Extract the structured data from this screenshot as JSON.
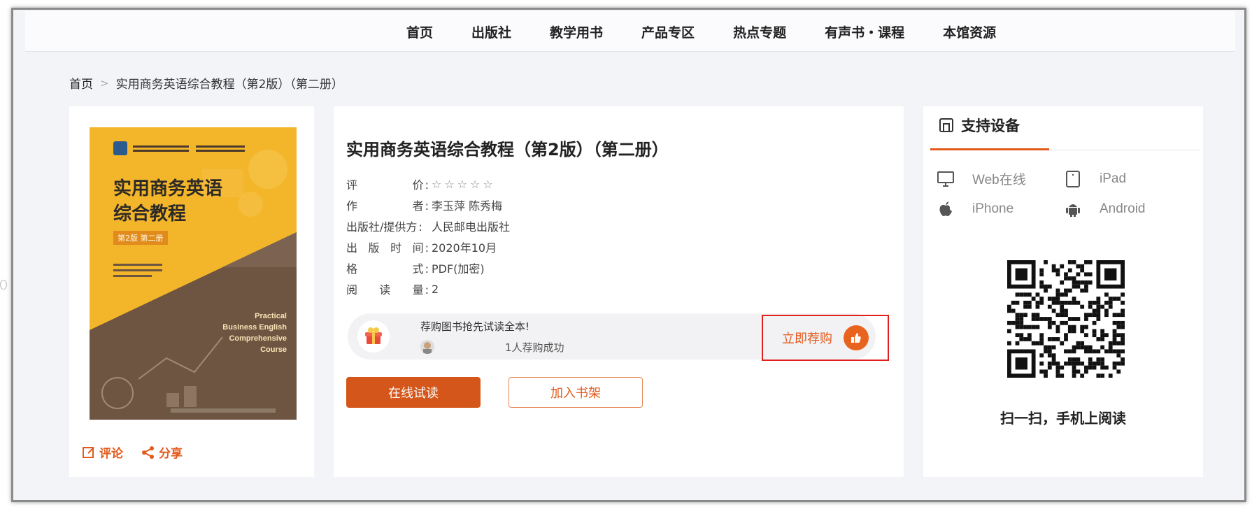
{
  "nav": {
    "items": [
      "首页",
      "出版社",
      "教学用书",
      "产品专区",
      "热点专题",
      "有声书・课程",
      "本馆资源"
    ]
  },
  "breadcrumb": {
    "home": "首页",
    "current": "实用商务英语综合教程（第2版）（第二册）"
  },
  "book": {
    "title": "实用商务英语综合教程（第2版）（第二册）",
    "cover": {
      "title_line1": "实用商务英语",
      "title_line2": "综合教程",
      "edition": "第2版 第二册",
      "english_lines": [
        "Practical",
        "Business English",
        "Comprehensive",
        "Course"
      ]
    },
    "meta": [
      {
        "label_chars": [
          "评",
          "价"
        ],
        "value": "",
        "type": "stars",
        "stars": "☆☆☆☆☆"
      },
      {
        "label_chars": [
          "作",
          "者"
        ],
        "value": "李玉萍 陈秀梅"
      },
      {
        "label_chars": [
          "出版社/提供方"
        ],
        "value": "人民邮电出版社"
      },
      {
        "label_chars": [
          "出",
          "版",
          "时",
          "间"
        ],
        "value": "2020年10月"
      },
      {
        "label_chars": [
          "格",
          "式"
        ],
        "value": "PDF(加密)"
      },
      {
        "label_chars": [
          "阅",
          "读",
          "量"
        ],
        "value": "2"
      }
    ],
    "rating": 0
  },
  "actions": {
    "comment": "评论",
    "share": "分享",
    "read_online": "在线试读",
    "add_shelf": "加入书架"
  },
  "promo": {
    "text": "荐购图书抢先试读全本!",
    "count_text": "1人荐购成功",
    "buy_label": "立即荐购"
  },
  "devices": {
    "header": "支持设备",
    "list": [
      {
        "name": "Web在线",
        "icon": "monitor-icon"
      },
      {
        "name": "iPad",
        "icon": "tablet-icon"
      },
      {
        "name": "iPhone",
        "icon": "apple-icon"
      },
      {
        "name": "Android",
        "icon": "android-icon"
      }
    ],
    "qr_caption": "扫一扫，手机上阅读"
  },
  "colors": {
    "accent": "#e25a1c",
    "highlight_border": "#e0201f",
    "cover_yellow": "#f3b52a",
    "cover_brown": "#6e5542"
  }
}
